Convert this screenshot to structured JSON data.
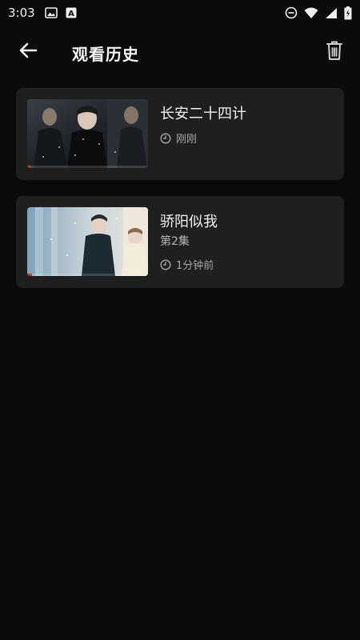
{
  "status_bar": {
    "time": "3:03",
    "left_icons": [
      "image-icon",
      "font-icon"
    ],
    "right_icons": [
      "dnd-icon",
      "wifi-icon",
      "signal-icon",
      "battery-charging-icon"
    ]
  },
  "header": {
    "title": "观看历史",
    "back_icon": "arrow-left-icon",
    "delete_icon": "trash-icon"
  },
  "history": [
    {
      "title": "长安二十四计",
      "episode": "",
      "time": "刚刚",
      "progress_fraction": 0.03,
      "thumbnail": "drama-poster-dark"
    },
    {
      "title": "骄阳似我",
      "episode": "第2集",
      "time": "1分钟前",
      "progress_fraction": 0.04,
      "thumbnail": "drama-poster-snow"
    }
  ],
  "colors": {
    "background": "#0b0b0b",
    "card": "#1f1f1f",
    "progress": "#c0392b"
  }
}
